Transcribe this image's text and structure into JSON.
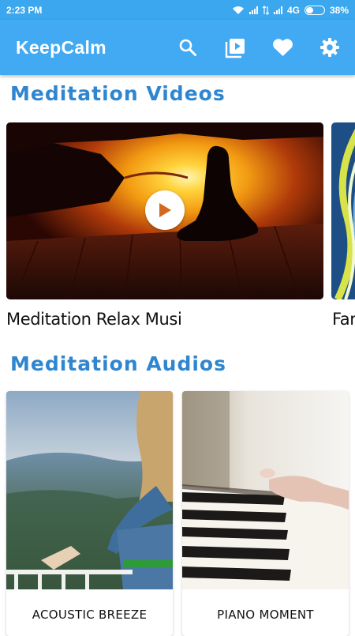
{
  "status": {
    "time": "2:23 PM",
    "network": "4G",
    "battery": "38%",
    "battery_level": 0.38
  },
  "app": {
    "title": "KeepCalm"
  },
  "icons": {
    "search": "search-icon",
    "videos": "video-library-icon",
    "favorites": "heart-icon",
    "settings": "gear-icon"
  },
  "sections": {
    "videos_title": "Meditation Videos",
    "audios_title": "Meditation Audios"
  },
  "videos": [
    {
      "caption": "Meditation Relax Musi"
    },
    {
      "caption": "Far"
    }
  ],
  "audios": [
    {
      "label": "ACOUSTIC BREEZE"
    },
    {
      "label": "PIANO MOMENT"
    }
  ],
  "colors": {
    "status_bar": "#3ba7ee",
    "app_bar": "#42a9f3",
    "section_title": "#2f86cf"
  }
}
